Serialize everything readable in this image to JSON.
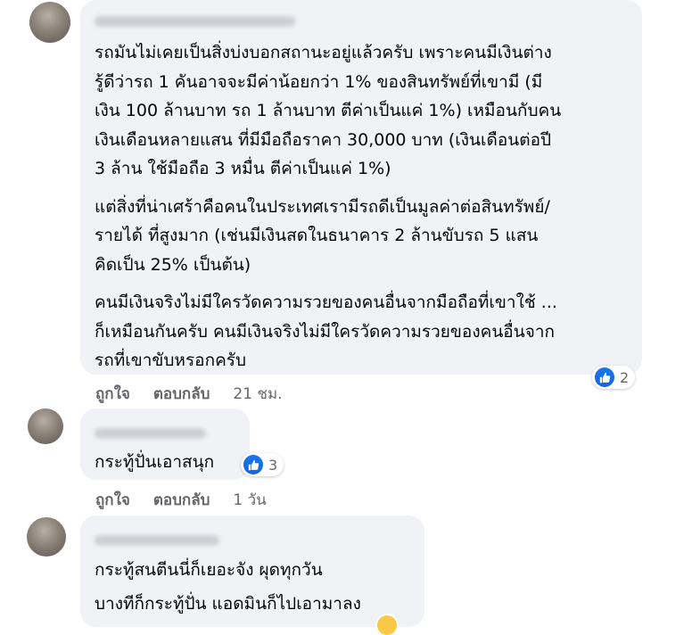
{
  "comments": [
    {
      "paragraphs": [
        [
          "รถมันไม่เคยเป็นสิ่งบ่งบอกสถานะอยู่แล้วครับ เพราะคนมีเงินต่าง",
          "รู้ดีว่ารถ 1 คันอาจจะมีค่าน้อยกว่า 1% ของสินทรัพย์ที่เขามี (มี",
          "เงิน 100 ล้านบาท รถ 1 ล้านบาท ตีค่าเป็นแค่ 1%) เหมือนกับคน",
          "เงินเดือนหลายแสน ที่มีมือถือราคา 30,000 บาท (เงินเดือนต่อปี",
          "3 ล้าน ใช้มือถือ 3 หมื่น ตีค่าเป็นแค่ 1%)"
        ],
        [
          "แต่สิ่งที่น่าเศร้าคือคนในประเทศเรามีรถดีเป็นมูลค่าต่อสินทรัพย์/",
          "รายได้ ที่สูงมาก (เช่นมีเงินสดในธนาคาร 2 ล้านขับรถ 5 แสน",
          "คิดเป็น 25% เป็นต้น)"
        ],
        [
          "คนมีเงินจริงไม่มีใครวัดความรวยของคนอื่นจากมือถือที่เขาใช้ ...",
          "ก็เหมือนกันครับ คนมีเงินจริงไม่มีใครวัดความรวยของคนอื่นจาก",
          "รถที่เขาขับหรอกครับ"
        ]
      ],
      "reaction_count": "2",
      "like_label": "ถูกใจ",
      "reply_label": "ตอบกลับ",
      "time": "21 ชม."
    },
    {
      "paragraphs": [
        [
          "กระทู้ปั่นเอาสนุก"
        ]
      ],
      "reaction_count": "3",
      "like_label": "ถูกใจ",
      "reply_label": "ตอบกลับ",
      "time": "1 วัน"
    },
    {
      "paragraphs": [
        [
          "กระทู้สนตีนนี่ก็เยอะจัง ผุดทุกวัน"
        ],
        [
          "บางทีก็กระทู้ปั่น แอดมินก็ไปเอามาลง"
        ]
      ]
    }
  ],
  "icons": {
    "like": "thumbs-up-icon",
    "haha": "haha-emoji-icon"
  },
  "colors": {
    "bubble": "#f0f2f5",
    "like_blue": "#1877f2",
    "meta_text": "#65676b"
  }
}
